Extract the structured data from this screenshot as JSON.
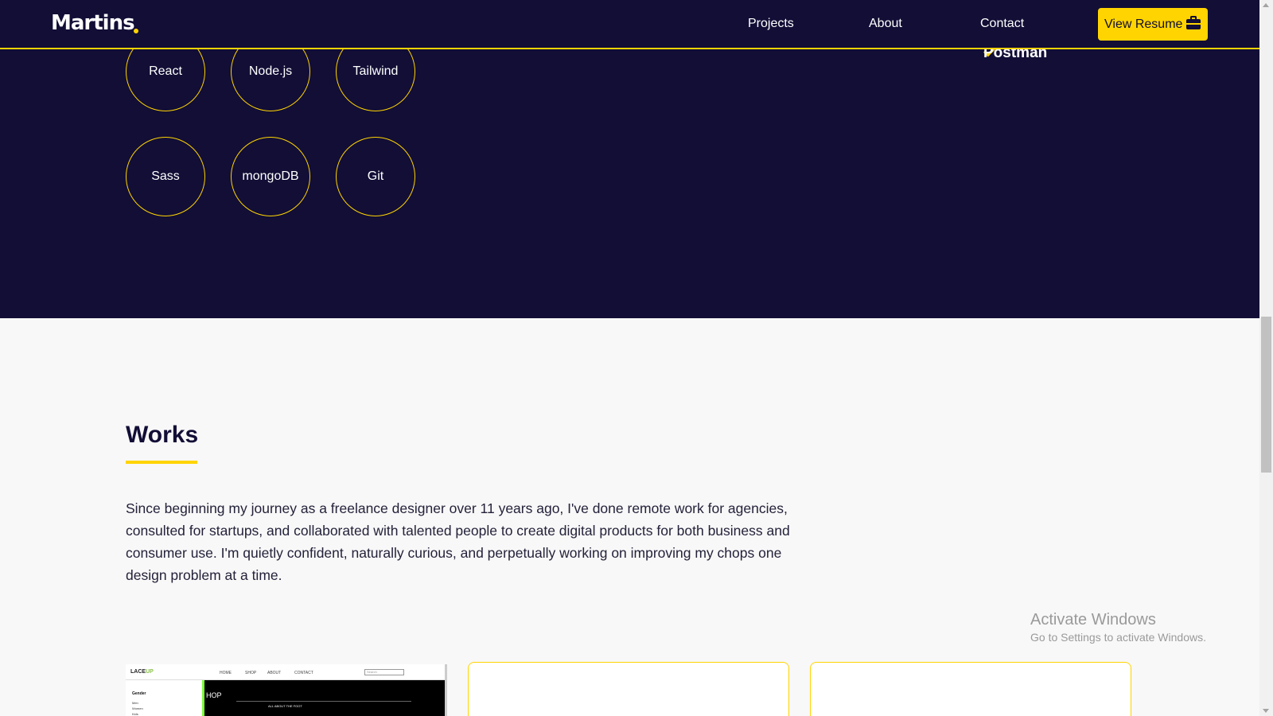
{
  "navbar": {
    "logo": "Martins",
    "links": [
      "Projects",
      "About",
      "Contact"
    ],
    "resume_label": "View Resume",
    "resume_icon": "briefcase-icon",
    "accent_color": "#ffd400",
    "background_color": "#120e36"
  },
  "skills": {
    "circles": [
      "React",
      "Node.js",
      "Tailwind",
      "Sass",
      "mongoDB",
      "Git"
    ],
    "tools_visible": [
      "Postman"
    ]
  },
  "works": {
    "title": "Works",
    "description": "Since beginning my journey as a freelance designer over 11 years ago, I've done remote work for agencies, consulted for startups, and collaborated with talented people to create digital products for both business and consumer use. I'm quietly confident, naturally curious, and perpetually working on improving my chops one design problem at a time.",
    "preview": {
      "brand_a": "LACE",
      "brand_b": "UP",
      "nav": [
        "HOME",
        "SHOP",
        "ABOUT",
        "CONTACT"
      ],
      "search": "Search",
      "sidebar_title": "Gender",
      "sidebar_options": [
        "Men",
        "Women",
        "Kids"
      ],
      "hero_text": "HOP",
      "hero_sub": "ALL ABOUT THE FOOT"
    }
  },
  "watermark": {
    "title": "Activate Windows",
    "subtitle": "Go to Settings to activate Windows."
  }
}
